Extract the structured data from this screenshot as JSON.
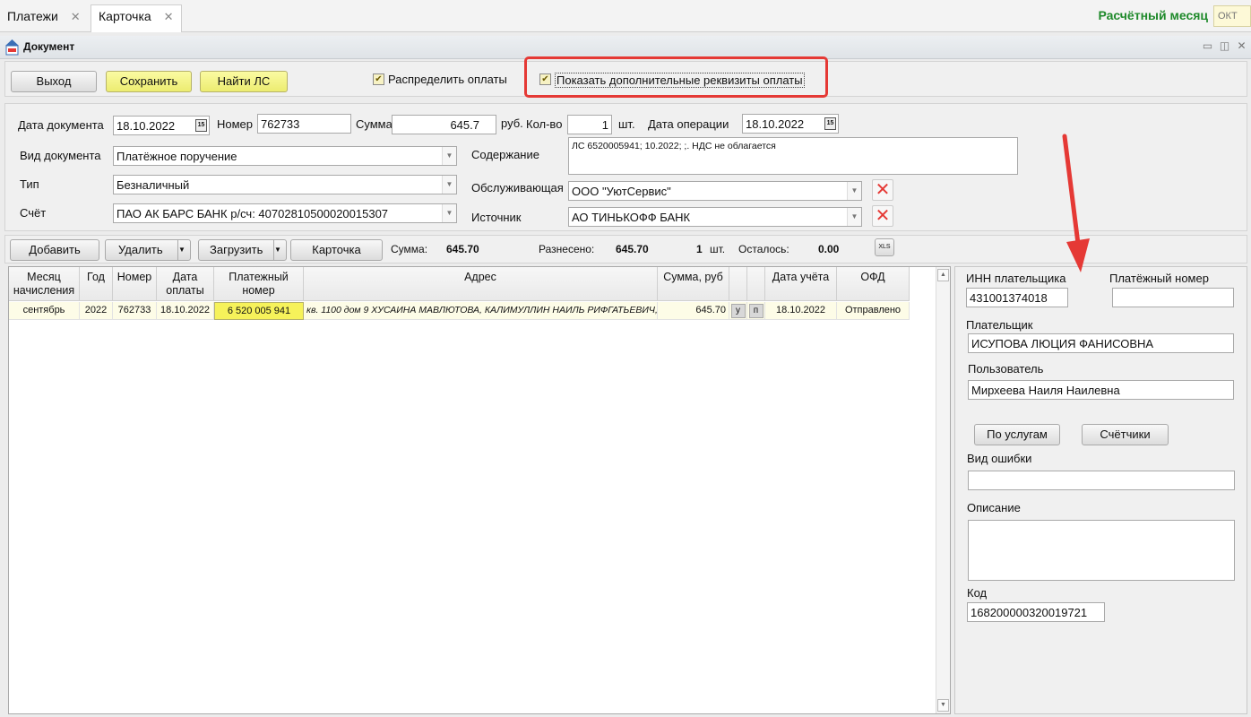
{
  "tabs": [
    {
      "label": "Платежи",
      "close": "✕"
    },
    {
      "label": "Карточка",
      "close": "✕"
    }
  ],
  "header": {
    "month_label": "Расчётный месяц",
    "month_value": "ОКТ"
  },
  "window": {
    "title": "Документ"
  },
  "toolbar": {
    "exit_label": "Выход",
    "save_label": "Сохранить",
    "find_ls_label": "Найти ЛС",
    "distribute_label": "Распределить оплаты",
    "distribute_checked": true,
    "show_extra_label": "Показать дополнительные реквизиты оплаты",
    "show_extra_checked": true
  },
  "form": {
    "doc_date_label": "Дата документа",
    "doc_date": "18.10.2022",
    "number_label": "Номер",
    "number": "762733",
    "sum_label": "Сумма",
    "sum": "645.7",
    "sum_unit": "руб.",
    "qty_label": "Кол-во",
    "qty": "1",
    "qty_unit": "шт.",
    "op_date_label": "Дата операции",
    "op_date": "18.10.2022",
    "doc_type_label": "Вид документа",
    "doc_type": "Платёжное поручение",
    "type_label": "Тип",
    "type": "Безналичный",
    "account_label": "Счёт",
    "account": "ПАО  АК БАРС  БАНК  р/сч: 40702810500020015307",
    "content_label": "Содержание",
    "content": "ЛС 6520005941; 10.2022; ;. НДС не облагается",
    "servicing_label": "Обслуживающая",
    "servicing": "ООО \"УютСервис\"",
    "source_label": "Источник",
    "source": "АО  ТИНЬКОФФ БАНК",
    "calendar_icon_text": "15",
    "remove_glyph": "✕"
  },
  "toolbar2": {
    "add_label": "Добавить",
    "delete_label": "Удалить",
    "load_label": "Загрузить",
    "card_label": "Карточка",
    "sum_label": "Сумма:",
    "sum": "645.70",
    "distributed_label": "Разнесено:",
    "distributed": "645.70",
    "count": "1",
    "count_unit": "шт.",
    "remaining_label": "Осталось:",
    "remaining": "0.00",
    "xls_label": "XLS"
  },
  "grid": {
    "columns": [
      "Месяц начисления",
      "Год",
      "Номер",
      "Дата оплаты",
      "Платежный номер",
      "Адрес",
      "Сумма, руб",
      "",
      "",
      "Дата учёта",
      "ОФД"
    ],
    "rows": [
      {
        "month": "сентябрь",
        "year": "2022",
        "number": "762733",
        "pay_date": "18.10.2022",
        "pay_number": "6 520 005 941",
        "address": "кв. 1100 дом 9 ХУСАИНА МАВЛЮТОВА, КАЛИМУЛЛИН НАИЛЬ РИФГАТЬЕВИЧ,",
        "sum": "645.70",
        "u": "у",
        "p": "п",
        "acc_date": "18.10.2022",
        "ofd": "Отправлено"
      }
    ]
  },
  "right_panel": {
    "inn_label": "ИНН плательщика",
    "inn": "431001374018",
    "pay_number_label": "Платёжный номер",
    "pay_number": "",
    "payer_label": "Плательщик",
    "payer": "ИСУПОВА ЛЮЦИЯ ФАНИСОВНА",
    "user_label": "Пользователь",
    "user": "Мирхеева Наиля Наилевна",
    "by_services_label": "По услугам",
    "meters_label": "Счётчики",
    "error_type_label": "Вид ошибки",
    "error_type": "",
    "description_label": "Описание",
    "description": "",
    "code_label": "Код",
    "code": "168200000320019721"
  },
  "colors": {
    "accent_green": "#1f8a2b",
    "highlight_red": "#e53935",
    "yellow_button": "#f2f286"
  }
}
